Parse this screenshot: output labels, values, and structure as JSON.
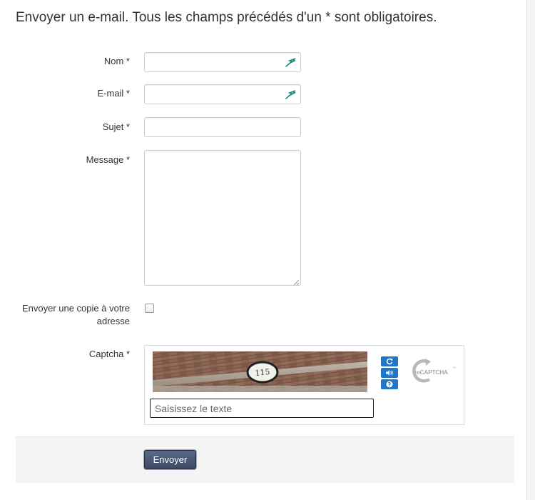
{
  "form": {
    "legend": "Envoyer un e-mail. Tous les champs précédés d'un * sont obligatoires.",
    "fields": {
      "name": {
        "label": "Nom *",
        "value": ""
      },
      "email": {
        "label": "E-mail *",
        "value": ""
      },
      "subject": {
        "label": "Sujet *",
        "value": ""
      },
      "message": {
        "label": "Message *",
        "value": ""
      }
    },
    "copy": {
      "label_line1": "Envoyer une copie à votre",
      "label_line2": "adresse",
      "checked": false
    },
    "captcha": {
      "label": "Captcha *",
      "input_placeholder": "Saisissez le texte",
      "image_number": "115",
      "buttons": [
        "refresh-icon",
        "audio-icon",
        "help-icon"
      ],
      "logo_text": "reCAPTCHA",
      "logo_tm": "™"
    },
    "submit_label": "Envoyer"
  }
}
